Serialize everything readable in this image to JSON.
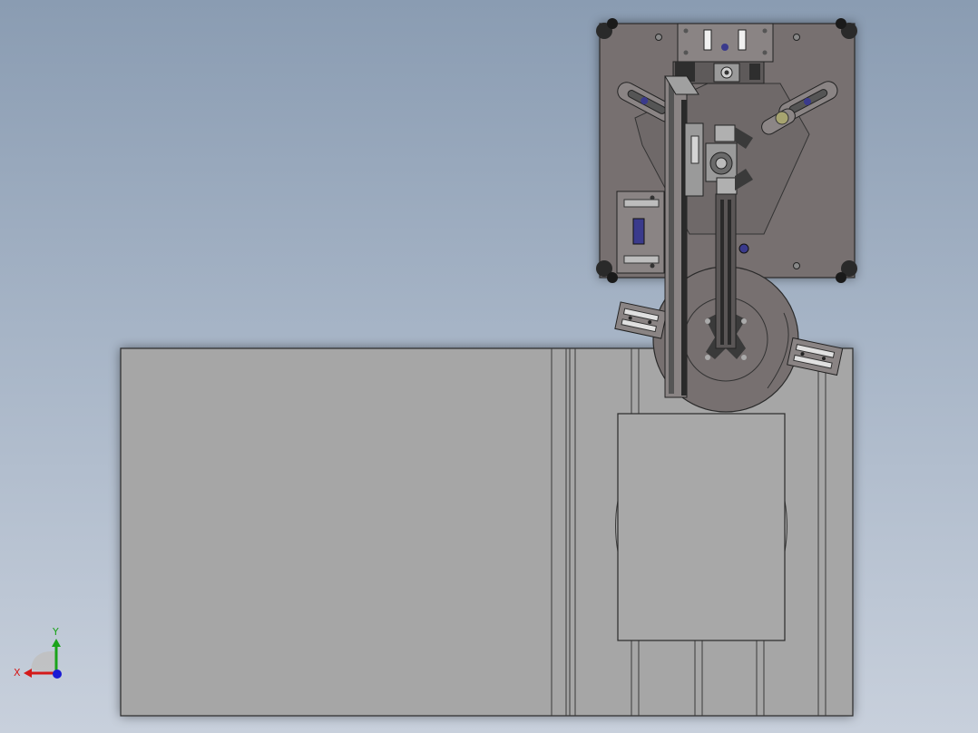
{
  "viewport": {
    "view_orientation": "top",
    "background_gradient": [
      "#8a9cb2",
      "#c8d0dc"
    ]
  },
  "model": {
    "base_plate_color": "#a6a6a6",
    "mechanism_plate_color": "#777070",
    "accent_color": "#3a3a8c"
  },
  "triad": {
    "x_label": "X",
    "y_label": "Y",
    "x_color": "#d41a1a",
    "y_color": "#1aa31a",
    "z_color": "#1a1ad4"
  }
}
